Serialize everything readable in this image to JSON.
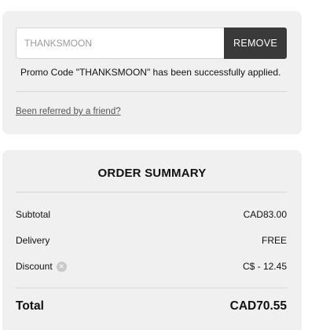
{
  "promo": {
    "code_value": "THANKSMOON",
    "remove_label": "REMOVE",
    "success_message": "Promo Code \"THANKSMOON\" has been successfully applied.",
    "referral_link": "Been referred by a friend?"
  },
  "summary": {
    "title": "ORDER SUMMARY",
    "subtotal_label": "Subtotal",
    "subtotal_value": "CAD83.00",
    "delivery_label": "Delivery",
    "delivery_value": "FREE",
    "discount_label": "Discount",
    "discount_value": "C$ - 12.45",
    "total_label": "Total",
    "total_value": "CAD70.55"
  },
  "icons": {
    "discount_remove": "close-circle-icon"
  },
  "colors": {
    "card_background": "#f0f0f0",
    "remove_button": "#3a3a3a"
  }
}
